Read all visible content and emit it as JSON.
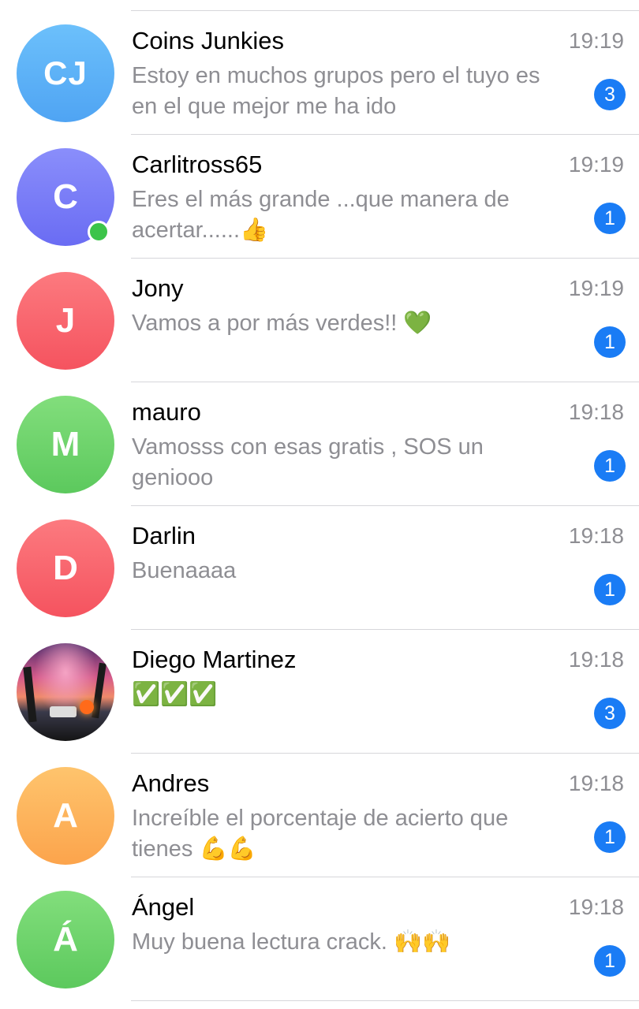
{
  "chats": [
    {
      "avatar_text": "CJ",
      "avatar_color": "#5fb1f7",
      "name": "Coins Junkies",
      "time": "19:19",
      "preview": "Estoy en muchos grupos pero el tuyo es\nen el que mejor me ha ido",
      "unread": "3",
      "online": false
    },
    {
      "avatar_text": "C",
      "avatar_color": "#7a7cf7",
      "name": "Carlitross65",
      "time": "19:19",
      "preview": "Eres el más grande ...que manera de\nacertar......👍",
      "unread": "1",
      "online": true
    },
    {
      "avatar_text": "J",
      "avatar_color": "#f8636e",
      "name": "Jony",
      "time": "19:19",
      "preview": "Vamos a por más verdes!! 💚",
      "unread": "1",
      "online": false
    },
    {
      "avatar_text": "M",
      "avatar_color": "#6fd46e",
      "name": "mauro",
      "time": "19:18",
      "preview": "Vamosss con esas gratis , SOS un\ngeniooo",
      "unread": "1",
      "online": false
    },
    {
      "avatar_text": "D",
      "avatar_color": "#f8636e",
      "name": "Darlin",
      "time": "19:18",
      "preview": "Buenaaaa",
      "unread": "1",
      "online": false
    },
    {
      "avatar_text": "",
      "avatar_color": "#d55a8a",
      "name": "Diego Martinez",
      "time": "19:18",
      "preview": "✅✅✅",
      "unread": "3",
      "online": false
    },
    {
      "avatar_text": "A",
      "avatar_color": "#fcb05a",
      "name": "Andres",
      "time": "19:18",
      "preview": "Increíble el porcentaje de acierto que\ntienes 💪💪",
      "unread": "1",
      "online": false
    },
    {
      "avatar_text": "Á",
      "avatar_color": "#6fd46e",
      "name": "Ángel",
      "time": "19:18",
      "preview": "Muy buena lectura crack. 🙌🙌",
      "unread": "1",
      "online": false
    }
  ]
}
